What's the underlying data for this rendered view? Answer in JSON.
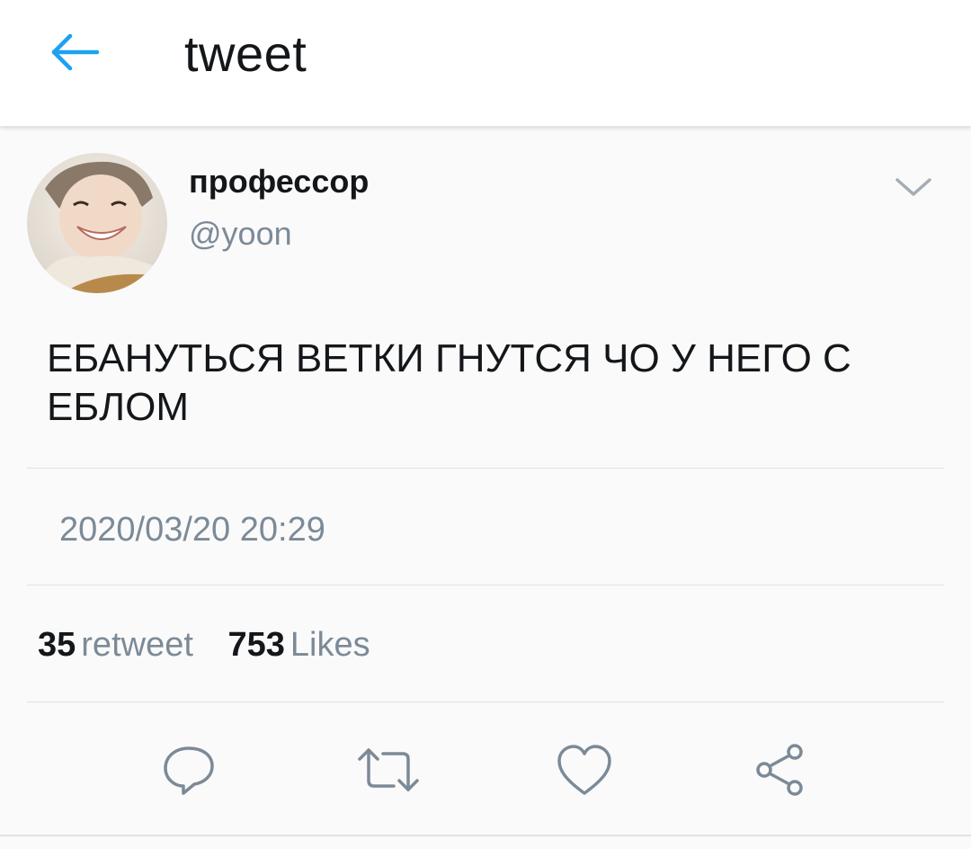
{
  "header": {
    "title": "tweet",
    "back_icon": "arrow-left-icon"
  },
  "tweet": {
    "author": {
      "display_name": "профессор",
      "handle": "@yoon"
    },
    "text": "ЕБАНУТЬСЯ ВЕТКИ ГНУТСЯ ЧО У НЕГО С ЕБЛОМ",
    "timestamp": "2020/03/20 20:29",
    "stats": {
      "retweet_count": "35",
      "retweet_label": "retweet",
      "like_count": "753",
      "like_label": "Likes"
    }
  },
  "actions": [
    "reply-icon",
    "retweet-icon",
    "heart-icon",
    "share-icon"
  ],
  "colors": {
    "accent": "#1da1f2",
    "text": "#14171a",
    "secondary": "#7c8a97"
  }
}
